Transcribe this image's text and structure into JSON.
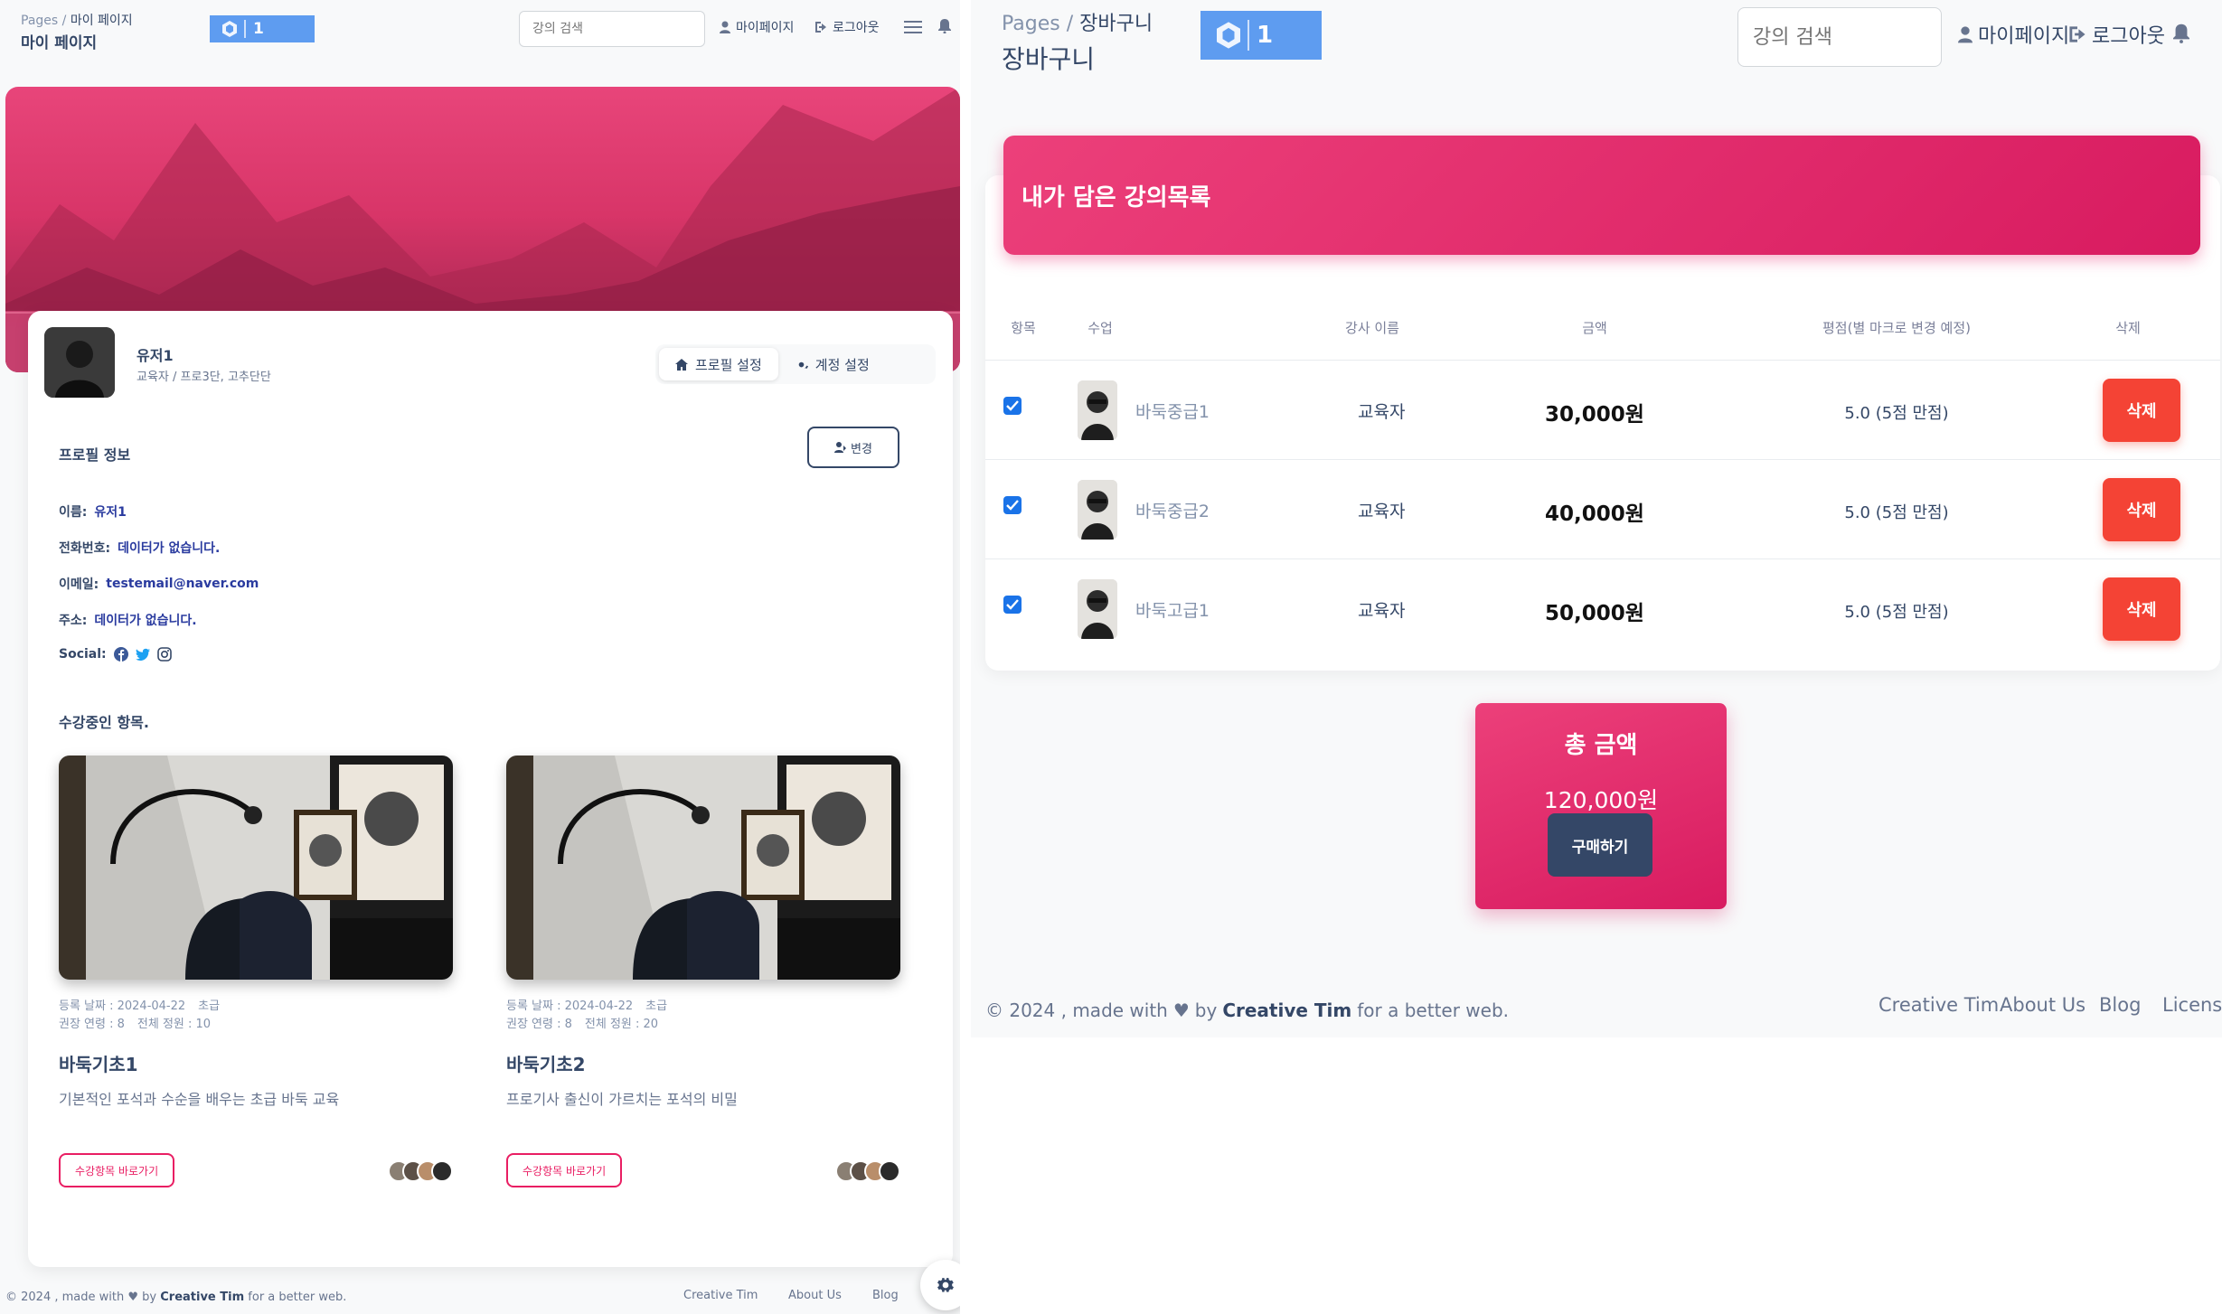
{
  "left": {
    "breadcrumb": {
      "root": "Pages",
      "separator": "/",
      "current": "마이 페이지"
    },
    "page_title": "마이 페이지",
    "notification_count": "1",
    "search_placeholder": "강의 검색",
    "nav": {
      "mypage": "마이페이지",
      "logout": "로그아웃"
    },
    "user": {
      "name": "유저1",
      "role": "교육자 / 프로3단, 고추단단"
    },
    "tabs": [
      {
        "label": "프로필 설정",
        "active": true
      },
      {
        "label": "계정 설정",
        "active": false
      }
    ],
    "profile": {
      "section_title": "프로필 정보",
      "edit_label": "변경",
      "rows": [
        {
          "key": "이름:",
          "value": "유저1"
        },
        {
          "key": "전화번호:",
          "value": "데이터가 없습니다."
        },
        {
          "key": "이메일:",
          "value": "testemail@naver.com"
        },
        {
          "key": "주소:",
          "value": "데이터가 없습니다."
        }
      ],
      "social_label": "Social:"
    },
    "enrolled_title": "수강중인 항목.",
    "courses": [
      {
        "reg_date": "등록 날짜 : 2024-04-22",
        "level": "초급",
        "age": "권장 연령 : 8",
        "capacity": "전체 정원 : 10",
        "title": "바둑기초1",
        "desc": "기본적인 포석과 수순을 배우는 초급 바둑 교육",
        "button": "수강항목 바로가기"
      },
      {
        "reg_date": "등록 날짜 : 2024-04-22",
        "level": "초급",
        "age": "권장 연령 : 8",
        "capacity": "전체 정원 : 20",
        "title": "바둑기초2",
        "desc": "프로기사 출신이 가르치는 포석의 비밀",
        "button": "수강항목 바로가기"
      }
    ],
    "footer": {
      "prefix": "© 2024 , made with",
      "by": "by",
      "brand": "Creative Tim",
      "suffix": "for a better web."
    },
    "footer_links": [
      "Creative Tim",
      "About Us",
      "Blog"
    ]
  },
  "right": {
    "breadcrumb": {
      "root": "Pages",
      "separator": "/",
      "current": "장바구니"
    },
    "page_title": "장바구니",
    "notification_count": "1",
    "search_placeholder": "강의 검색",
    "nav": {
      "mypage": "마이페이지",
      "logout": "로그아웃"
    },
    "cart_title": "내가 담은 강의목록",
    "columns": [
      "항목",
      "수업",
      "강사 이름",
      "금액",
      "평점(별 마크로 변경 예정)",
      "삭제"
    ],
    "rows": [
      {
        "checked": true,
        "course": "바둑중급1",
        "teacher": "교육자",
        "price": "30,000원",
        "rating": "5.0 (5점 만점)",
        "delete": "삭제"
      },
      {
        "checked": true,
        "course": "바둑중급2",
        "teacher": "교육자",
        "price": "40,000원",
        "rating": "5.0 (5점 만점)",
        "delete": "삭제"
      },
      {
        "checked": true,
        "course": "바둑고급1",
        "teacher": "교육자",
        "price": "50,000원",
        "rating": "5.0 (5점 만점)",
        "delete": "삭제"
      }
    ],
    "total": {
      "label": "총 금액",
      "value": "120,000원",
      "buy": "구매하기"
    },
    "footer": {
      "prefix": "© 2024 , made with",
      "by": "by",
      "brand": "Creative Tim",
      "suffix": "for a better web."
    },
    "footer_links": [
      "Creative Tim",
      "About Us",
      "Blog",
      "License"
    ]
  },
  "colors": {
    "accent": "#e91e63",
    "danger": "#f44335",
    "dark": "#344767",
    "badge": "#5e9cf0"
  }
}
